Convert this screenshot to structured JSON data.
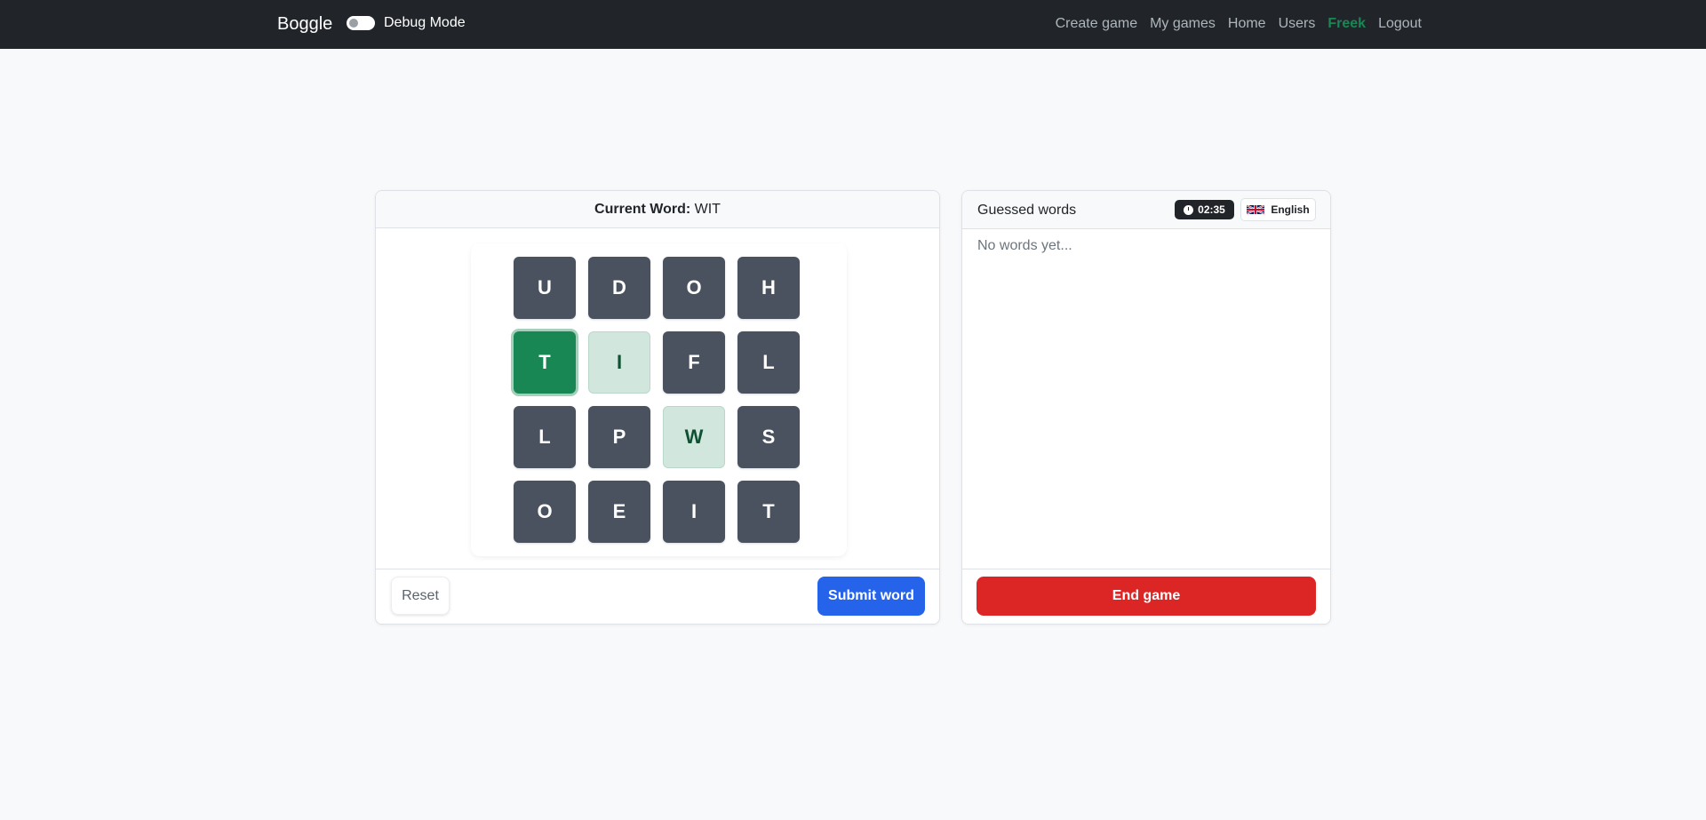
{
  "navbar": {
    "brand": "Boggle",
    "debug_label": "Debug Mode",
    "debug_enabled": false,
    "links": [
      {
        "label": "Create game"
      },
      {
        "label": "My games"
      },
      {
        "label": "Home"
      },
      {
        "label": "Users"
      },
      {
        "label": "Freek"
      },
      {
        "label": "Logout"
      }
    ]
  },
  "game": {
    "current_word_label": "Current Word:",
    "current_word": "WIT",
    "board": [
      {
        "letter": "U",
        "state": "normal"
      },
      {
        "letter": "D",
        "state": "normal"
      },
      {
        "letter": "O",
        "state": "normal"
      },
      {
        "letter": "H",
        "state": "normal"
      },
      {
        "letter": "T",
        "state": "active"
      },
      {
        "letter": "I",
        "state": "selected"
      },
      {
        "letter": "F",
        "state": "normal"
      },
      {
        "letter": "L",
        "state": "normal"
      },
      {
        "letter": "L",
        "state": "normal"
      },
      {
        "letter": "P",
        "state": "normal"
      },
      {
        "letter": "W",
        "state": "selected"
      },
      {
        "letter": "S",
        "state": "normal"
      },
      {
        "letter": "O",
        "state": "normal"
      },
      {
        "letter": "E",
        "state": "normal"
      },
      {
        "letter": "I",
        "state": "normal"
      },
      {
        "letter": "T",
        "state": "normal"
      }
    ],
    "reset_label": "Reset",
    "submit_label": "Submit word"
  },
  "guessed": {
    "title": "Guessed words",
    "timer": "02:35",
    "language": "English",
    "empty_text": "No words yet...",
    "end_label": "End game"
  },
  "colors": {
    "navbar": "#212529",
    "tile": "#4a5260",
    "tile_selected": "#d1e7dd",
    "tile_active": "#198754",
    "submit": "#2563eb",
    "end_game": "#dc2626",
    "user_link": "#198754"
  },
  "icons": {
    "timer": "clock-icon",
    "language": "uk-flag-icon"
  }
}
